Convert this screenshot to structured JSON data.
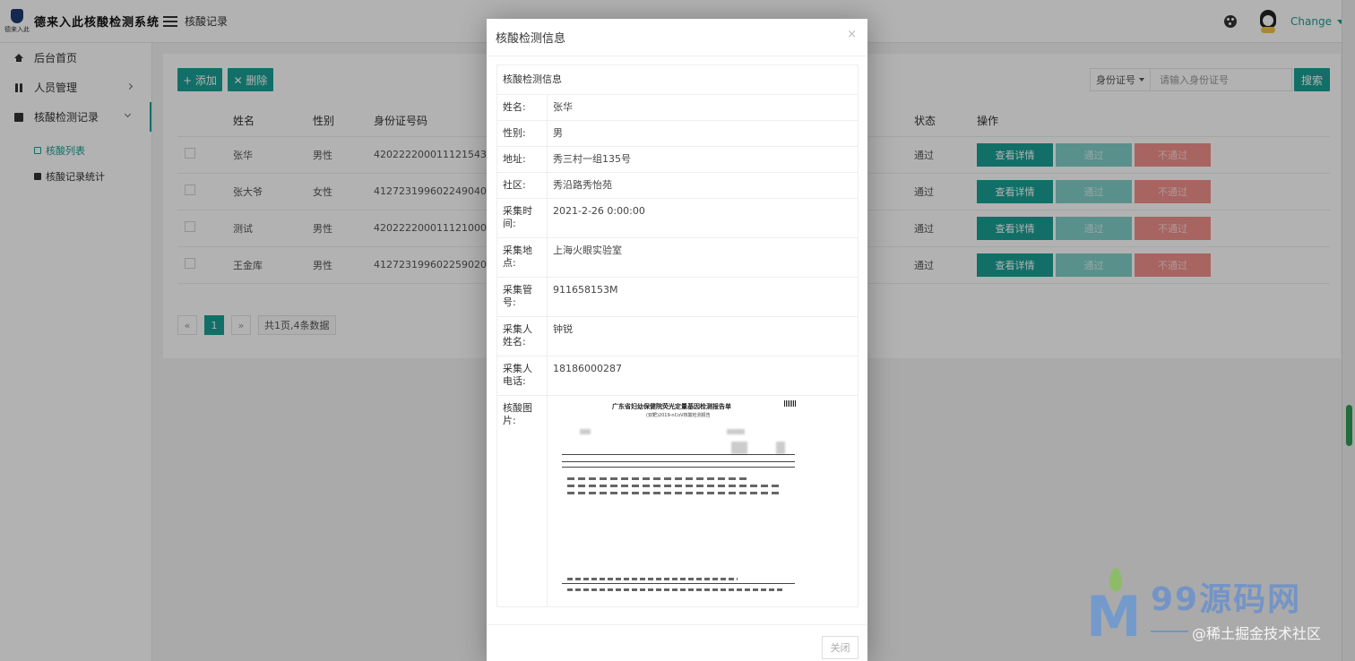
{
  "header": {
    "logo_sub": "德来入此",
    "logo_text": "德来入此核酸检测系统",
    "breadcrumb": "核酸记录",
    "user_name": "Change"
  },
  "sidebar": {
    "items": [
      {
        "label": "后台首页"
      },
      {
        "label": "人员管理"
      },
      {
        "label": "核酸检测记录"
      }
    ],
    "subitems": [
      {
        "label": "核酸列表"
      },
      {
        "label": "核酸记录统计"
      }
    ]
  },
  "toolbar": {
    "add_label": "+ 添加",
    "delete_label": "✕ 删除",
    "id_type": "身份证号",
    "search_placeholder": "请输入身份证号",
    "search_label": "搜索"
  },
  "table": {
    "headers": {
      "name": "姓名",
      "gender": "性别",
      "id": "身份证号码",
      "status": "状态",
      "ops": "操作"
    },
    "rows": [
      {
        "name": "张华",
        "gender": "男性",
        "id": "420222200011121543",
        "status": "通过"
      },
      {
        "name": "张大爷",
        "gender": "女性",
        "id": "412723199602249040",
        "status": "通过"
      },
      {
        "name": "测试",
        "gender": "男性",
        "id": "420222200011121000",
        "status": "通过"
      },
      {
        "name": "王金库",
        "gender": "男性",
        "id": "412723199602259020",
        "status": "通过"
      }
    ],
    "op_labels": {
      "detail": "查看详情",
      "pass": "通过",
      "fail": "不通过"
    }
  },
  "pager": {
    "prev": "«",
    "current": "1",
    "next": "»",
    "info": "共1页,4条数据"
  },
  "modal": {
    "title": "核酸检测信息",
    "close_x": "×",
    "section_title": "核酸检测信息",
    "fields": [
      {
        "key": "姓名:",
        "value": "张华"
      },
      {
        "key": "性别:",
        "value": "男"
      },
      {
        "key": "地址:",
        "value": "秀三村一组135号"
      },
      {
        "key": "社区:",
        "value": "秀沿路秀怡苑"
      },
      {
        "key": "采集时间:",
        "value": "2021-2-26 0:00:00"
      },
      {
        "key": "采集地点:",
        "value": "上海火眼实验室"
      },
      {
        "key": "采集管号:",
        "value": "911658153M"
      },
      {
        "key": "采集人姓名:",
        "value": "钟锐"
      },
      {
        "key": "采集人电话:",
        "value": "18186000287"
      }
    ],
    "image_key": "核酸图片:",
    "report": {
      "title": "广东省妇幼保健院荧光定量基因检测报告单",
      "subtitle": "(双靶)2019-nCoV核酸检测报告"
    },
    "close_label": "关闭"
  },
  "watermark": {
    "title": "99源码网",
    "sub": "@稀土掘金技术社区"
  },
  "colors": {
    "accent": "#1aa094",
    "danger": "#f0908c"
  }
}
